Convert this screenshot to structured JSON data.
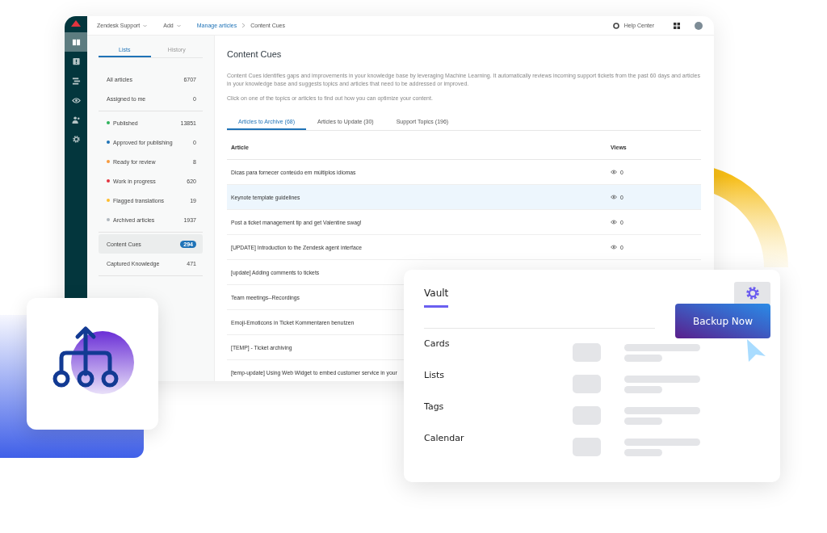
{
  "app": {
    "topbar": {
      "product": "Zendesk Support",
      "add": "Add",
      "breadcrumb": [
        {
          "label": "Manage articles",
          "link": true
        },
        {
          "label": "Content Cues",
          "link": false
        }
      ],
      "help": "Help Center"
    },
    "nav_icons": [
      {
        "kind": "book",
        "selected": true
      },
      {
        "kind": "alert",
        "selected": false
      },
      {
        "kind": "list",
        "selected": false
      },
      {
        "kind": "eye",
        "selected": false
      },
      {
        "kind": "people",
        "selected": false
      },
      {
        "kind": "gear",
        "selected": false
      }
    ],
    "panel": {
      "tabs": [
        {
          "label": "Lists",
          "selected": true
        },
        {
          "label": "History",
          "selected": false
        }
      ],
      "groups": [
        [
          {
            "label": "All articles",
            "count": "6707",
            "selected": false
          },
          {
            "label": "Assigned to me",
            "count": "0",
            "selected": false
          }
        ],
        [
          {
            "label": "Published",
            "count": "13851",
            "color": "#2fb35c",
            "selected": false
          },
          {
            "label": "Approved for publishing",
            "count": "0",
            "color": "#1f73b7",
            "selected": false
          },
          {
            "label": "Ready for review",
            "count": "8",
            "color": "#f79a3e",
            "selected": false
          },
          {
            "label": "Work in progress",
            "count": "620",
            "color": "#e3343f",
            "selected": false
          },
          {
            "label": "Flagged translations",
            "count": "19",
            "color": "#ffbd2e",
            "selected": false
          },
          {
            "label": "Archived articles",
            "count": "1937",
            "color": "#b0b8be",
            "selected": false
          }
        ],
        [
          {
            "label": "Content Cues",
            "count": "294",
            "selected": true
          },
          {
            "label": "Captured Knowledge",
            "count": "471",
            "selected": false
          }
        ]
      ]
    },
    "main": {
      "title": "Content Cues",
      "description": "Content Cues identifies gaps and improvements in your knowledge base by leveraging Machine Learning. It automatically reviews incoming support tickets from the past 60 days and articles in your knowledge base and suggests topics and articles that need to be addressed or improved.",
      "hint": "Click on one of the topics or articles to find out how you can optimize your content.",
      "tabs": [
        {
          "label": "Articles to Archive (68)",
          "selected": true
        },
        {
          "label": "Articles to Update (30)",
          "selected": false
        },
        {
          "label": "Support Topics (196)",
          "selected": false
        }
      ],
      "columns": [
        "Article",
        "Views"
      ],
      "rows": [
        {
          "article": "Dicas para fornecer conteúdo em múltiplos idiomas",
          "views": "0",
          "selected": false
        },
        {
          "article": "Keynote template guidelines",
          "views": "0",
          "selected": true
        },
        {
          "article": "Post a ticket management tip and get Valentine swag!",
          "views": "0",
          "selected": false
        },
        {
          "article": "[UPDATE] Introduction to the Zendesk agent interface",
          "views": "0",
          "selected": false
        },
        {
          "article": "[update] Adding comments to tickets",
          "selected": false
        },
        {
          "article": "Team meetings--Recordings",
          "selected": false
        },
        {
          "article": "Emoji-Emoticons in Ticket Kommentaren benutzen",
          "selected": false
        },
        {
          "article": "[TEMP] - Ticket archiving",
          "selected": false
        },
        {
          "article": "[temp-update] Using Web Widget to embed customer service in your",
          "selected": false
        }
      ]
    }
  },
  "vault": {
    "title": "Vault",
    "items": [
      "Cards",
      "Lists",
      "Tags",
      "Calendar"
    ],
    "button": "Backup Now"
  }
}
